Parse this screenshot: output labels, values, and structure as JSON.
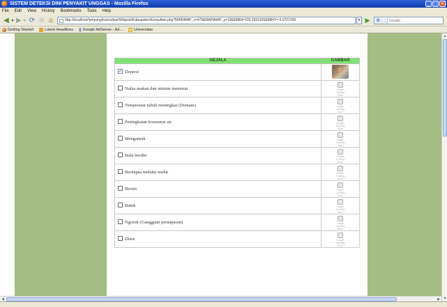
{
  "window": {
    "title": "SISTEM DETEKSI DINI PENYAKIT UNGGAS - Mozilla Firefox"
  },
  "menu": [
    "File",
    "Edit",
    "View",
    "History",
    "Bookmarks",
    "Tools",
    "Help"
  ],
  "navigation": {
    "url": "http://localhost/lampung/konsultasi/Wilayah/Kabupaten/Konsultasi.php?MAINMAP_x=479&MAINMAP_y=196&MINI=103.2931926&MINY=-5.9721556",
    "search_placeholder": "Google",
    "search_engine_icon": "G"
  },
  "bookmarks": [
    {
      "label": "Getting Started",
      "icon": "firefox-icon"
    },
    {
      "label": "Latest Headlines",
      "icon": "rss-feed-icon"
    },
    {
      "label": "Google AdSense - Ad...",
      "icon": "google-icon"
    },
    {
      "label": "Universitas",
      "icon": "folder-icon"
    }
  ],
  "table": {
    "header_symptom": "GEJALA",
    "header_image": "GAMBAR",
    "no_image_caption": "Image Coming Soon",
    "rows": [
      {
        "label": "Depresi",
        "checked": true,
        "has_photo": true
      },
      {
        "label": "Nafsu makan dan minum menurun",
        "checked": false,
        "has_photo": false
      },
      {
        "label": "Temperatur tubuh meningkat (Demam)",
        "checked": false,
        "has_photo": false
      },
      {
        "label": "Peningkatan konsumsi air",
        "checked": false,
        "has_photo": false
      },
      {
        "label": "Mengantuk",
        "checked": false,
        "has_photo": false
      },
      {
        "label": "Bulu berdiri",
        "checked": false,
        "has_photo": false
      },
      {
        "label": "Bernapas melalui mulut",
        "checked": false,
        "has_photo": false
      },
      {
        "label": "Bersin",
        "checked": false,
        "has_photo": false
      },
      {
        "label": "Batuk",
        "checked": false,
        "has_photo": false
      },
      {
        "label": "Ngorok (Gangguan pernapasan)",
        "checked": false,
        "has_photo": false
      },
      {
        "label": "Diare",
        "checked": false,
        "has_photo": false
      }
    ]
  },
  "colors": {
    "sidebar_green": "#a3bd82",
    "header_green": "#7fe373",
    "titlebar_blue": "#1a4cc6"
  }
}
